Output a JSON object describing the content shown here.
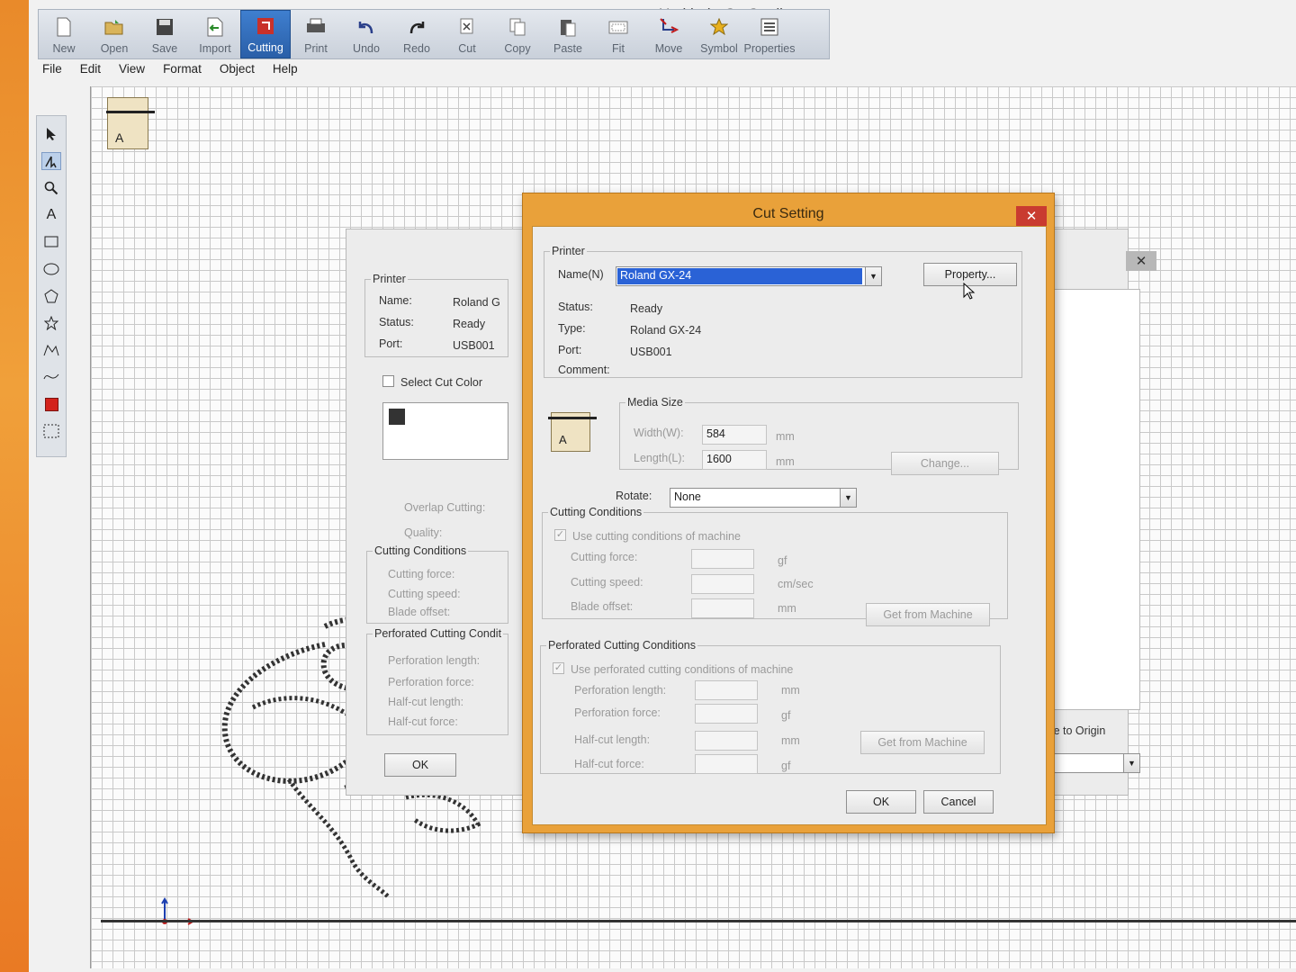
{
  "window": {
    "title": "Untitled - CutStudio"
  },
  "ribbon": {
    "buttons": [
      {
        "label": "New",
        "icon": "new-doc-icon"
      },
      {
        "label": "Open",
        "icon": "open-folder-icon"
      },
      {
        "label": "Save",
        "icon": "save-disk-icon"
      },
      {
        "label": "Import",
        "icon": "import-icon"
      },
      {
        "label": "Cutting",
        "icon": "cutting-icon",
        "active": true
      },
      {
        "label": "Print",
        "icon": "printer-icon"
      },
      {
        "label": "Undo",
        "icon": "undo-icon"
      },
      {
        "label": "Redo",
        "icon": "redo-icon"
      },
      {
        "label": "Cut",
        "icon": "scissors-icon"
      },
      {
        "label": "Copy",
        "icon": "copy-icon"
      },
      {
        "label": "Paste",
        "icon": "paste-icon"
      },
      {
        "label": "Fit",
        "icon": "fit-icon"
      },
      {
        "label": "Move",
        "icon": "move-icon"
      },
      {
        "label": "Symbol",
        "icon": "star-symbol-icon"
      },
      {
        "label": "Properties",
        "icon": "properties-icon"
      }
    ]
  },
  "menu": [
    "File",
    "Edit",
    "View",
    "Format",
    "Object",
    "Help"
  ],
  "toolbox": [
    "arrow-select-icon",
    "node-edit-icon",
    "zoom-icon",
    "text-icon",
    "rectangle-icon",
    "ellipse-icon",
    "polygon-icon",
    "star-icon",
    "polyline-icon",
    "curve-icon",
    "color-swatch-icon",
    "marquee-icon"
  ],
  "media_label": "A",
  "bg_dialog": {
    "printer_group": "Printer",
    "name_label": "Name:",
    "name_value": "Roland G",
    "status_label": "Status:",
    "status_value": "Ready",
    "port_label": "Port:",
    "port_value": "USB001",
    "select_cut_color": "Select Cut Color",
    "overlap_cutting": "Overlap Cutting:",
    "quality": "Quality:",
    "cutting_conditions": "Cutting Conditions",
    "cutting_force": "Cutting force:",
    "cutting_speed": "Cutting speed:",
    "blade_offset": "Blade offset:",
    "perforated_group": "Perforated Cutting Condit",
    "perforation_length": "Perforation length:",
    "perforation_force": "Perforation  force:",
    "half_cut_length": "Half-cut length:",
    "half_cut_force": "Half-cut force:",
    "ok": "OK",
    "move_to_origin": "Move to Origin"
  },
  "cut_setting": {
    "title": "Cut Setting",
    "printer_group": "Printer",
    "name_label": "Name(N)",
    "name_value": "Roland GX-24",
    "property_button": "Property...",
    "status_label": "Status:",
    "status_value": "Ready",
    "type_label": "Type:",
    "type_value": "Roland GX-24",
    "port_label": "Port:",
    "port_value": "USB001",
    "comment_label": "Comment:",
    "media_size_group": "Media Size",
    "width_label": "Width(W):",
    "width_value": "584",
    "width_unit": "mm",
    "length_label": "Length(L):",
    "length_value": "1600",
    "length_unit": "mm",
    "change_button": "Change...",
    "rotate_label": "Rotate:",
    "rotate_value": "None",
    "cutting_conditions_group": "Cutting Conditions",
    "use_machine_conditions": "Use cutting conditions of machine",
    "cutting_force_label": "Cutting force:",
    "cutting_force_unit": "gf",
    "cutting_speed_label": "Cutting speed:",
    "cutting_speed_unit": "cm/sec",
    "blade_offset_label": "Blade offset:",
    "blade_offset_unit": "mm",
    "get_from_machine_1": "Get from Machine",
    "perforated_group": "Perforated Cutting Conditions",
    "use_perforated_machine": "Use perforated cutting conditions of machine",
    "perforation_length_label": "Perforation length:",
    "perforation_length_unit": "mm",
    "perforation_force_label": "Perforation  force:",
    "perforation_force_unit": "gf",
    "half_cut_length_label": "Half-cut length:",
    "half_cut_length_unit": "mm",
    "half_cut_force_label": "Half-cut force:",
    "half_cut_force_unit": "gf",
    "get_from_machine_2": "Get from Machine",
    "ok": "OK",
    "cancel": "Cancel"
  }
}
